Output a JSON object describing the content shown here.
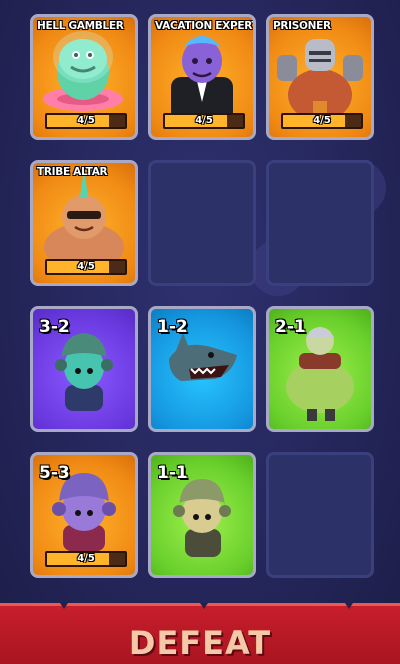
{
  "cards": [
    {
      "title": "HELL GAMBLER",
      "progress_text": "4/5",
      "progress": 0.8
    },
    {
      "title": "VACATION EXPERT",
      "progress_text": "4/5",
      "progress": 0.8
    },
    {
      "title": "PRISONER",
      "progress_text": "4/5",
      "progress": 0.8
    },
    {
      "title": "TRIBE ALTAR",
      "progress_text": "4/5",
      "progress": 0.8
    },
    {
      "level": "3-2"
    },
    {
      "level": "1-2"
    },
    {
      "level": "2-1"
    },
    {
      "level": "5-3",
      "progress_text": "4/5",
      "progress": 0.8
    },
    {
      "level": "1-1"
    }
  ],
  "footer": {
    "label": "DEFEAT"
  },
  "colors": {
    "orange": "#f08a14",
    "purple": "#6a3ae0",
    "blue": "#1597e0",
    "green": "#69cf2c",
    "defeat_red": "#c81e2c"
  }
}
